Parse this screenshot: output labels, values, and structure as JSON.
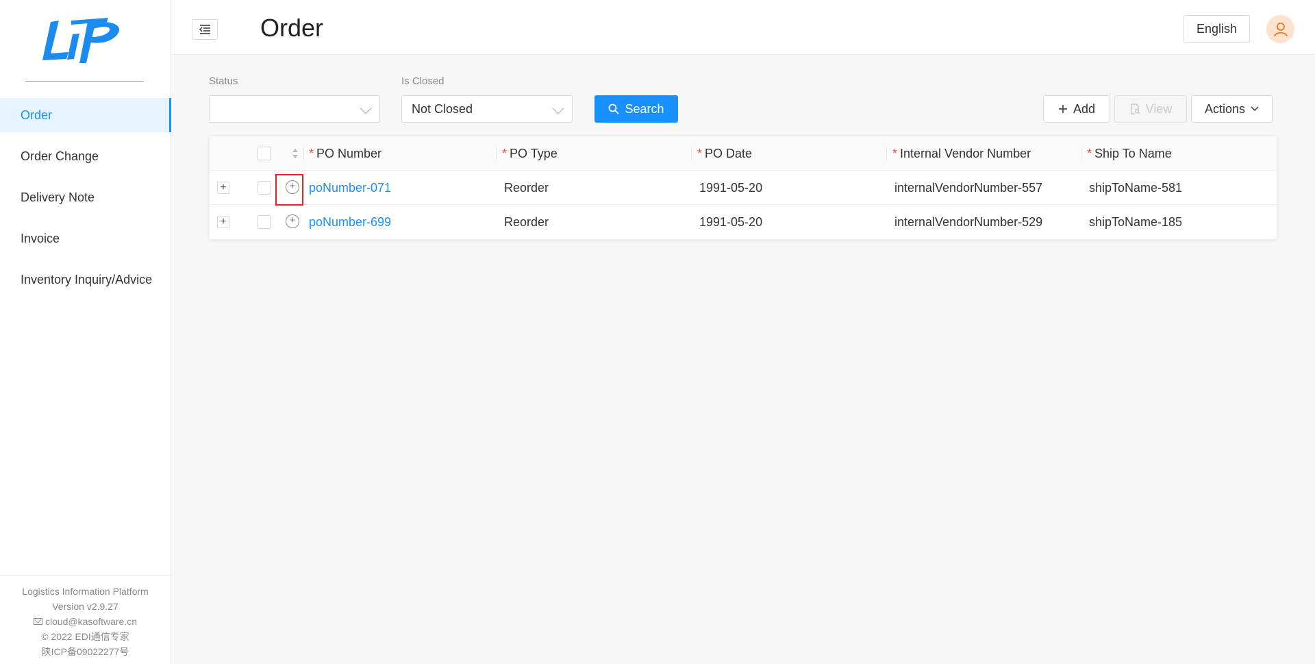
{
  "app": {
    "page_title": "Order",
    "language": "English"
  },
  "sidebar": {
    "items": [
      {
        "label": "Order",
        "active": true
      },
      {
        "label": "Order Change"
      },
      {
        "label": "Delivery Note"
      },
      {
        "label": "Invoice"
      },
      {
        "label": "Inventory Inquiry/Advice"
      }
    ],
    "footer": {
      "platform": "Logistics Information Platform",
      "version": "Version v2.9.27",
      "email": "cloud@kasoftware.cn",
      "copyright": "© 2022 EDI通信专家",
      "icp": "陕ICP备09022277号"
    }
  },
  "filters": {
    "status_label": "Status",
    "status_value": "",
    "is_closed_label": "Is Closed",
    "is_closed_value": "Not Closed",
    "search_label": "Search"
  },
  "toolbar": {
    "add_label": "Add",
    "view_label": "View",
    "actions_label": "Actions"
  },
  "table": {
    "columns": [
      "PO Number",
      "PO Type",
      "PO Date",
      "Internal Vendor Number",
      "Ship To Name"
    ],
    "rows": [
      {
        "po_number": "poNumber-071",
        "po_type": "Reorder",
        "po_date": "1991-05-20",
        "vendor": "internalVendorNumber-557",
        "ship_to": "shipToName-581"
      },
      {
        "po_number": "poNumber-699",
        "po_type": "Reorder",
        "po_date": "1991-05-20",
        "vendor": "internalVendorNumber-529",
        "ship_to": "shipToName-185"
      }
    ]
  },
  "colors": {
    "accent": "#1890ff",
    "required": "#ff4d4f",
    "highlight": "#e8202a",
    "avatar_bg": "#fde3cf",
    "avatar_icon": "#f56a00"
  }
}
